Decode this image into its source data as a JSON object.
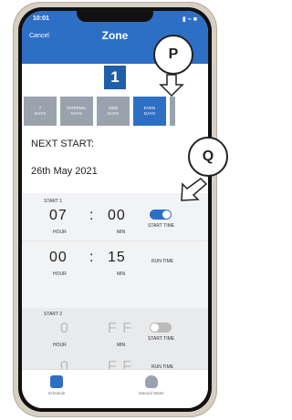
{
  "status": {
    "time": "10:01",
    "icons": "▮ ⌁ ■"
  },
  "header": {
    "cancel": "Cancel",
    "title": "Zone"
  },
  "zone_number": "1",
  "days": [
    {
      "label": "7\nDAYS",
      "active": false
    },
    {
      "label": "INTERVAL\nDAYS",
      "active": false
    },
    {
      "label": "ODD\nDAYS",
      "active": false
    },
    {
      "label": "EVEN\nDAYS",
      "active": true
    }
  ],
  "next_start": {
    "label": "NEXT START:",
    "date": "26th May 2021"
  },
  "start1": {
    "label": "START 1",
    "hour": "07",
    "colon": ":",
    "min": "00",
    "hour_label": "HOUR",
    "min_label": "MIN",
    "toggle_label": "START TIME",
    "run_hour": "00",
    "run_min": "15",
    "run_label": "RUN TIME",
    "toggle_on": true
  },
  "start2": {
    "label": "START 2",
    "hour": "0",
    "min": "F F",
    "hour_label": "HOUR",
    "min_label": "MIN",
    "toggle_label": "START TIME",
    "run_hour": "0",
    "run_min": "F F",
    "run_label": "RUN TIME",
    "toggle_on": false
  },
  "tabs": [
    {
      "label": "Schedule",
      "icon": "calendar-icon",
      "active": true
    },
    {
      "label": "Manual Water",
      "icon": "hand-pointer-icon",
      "active": false
    }
  ],
  "callouts": {
    "p": "P",
    "q": "Q"
  },
  "colors": {
    "accent": "#2e6fc6",
    "inactive": "#9aa3ad"
  }
}
